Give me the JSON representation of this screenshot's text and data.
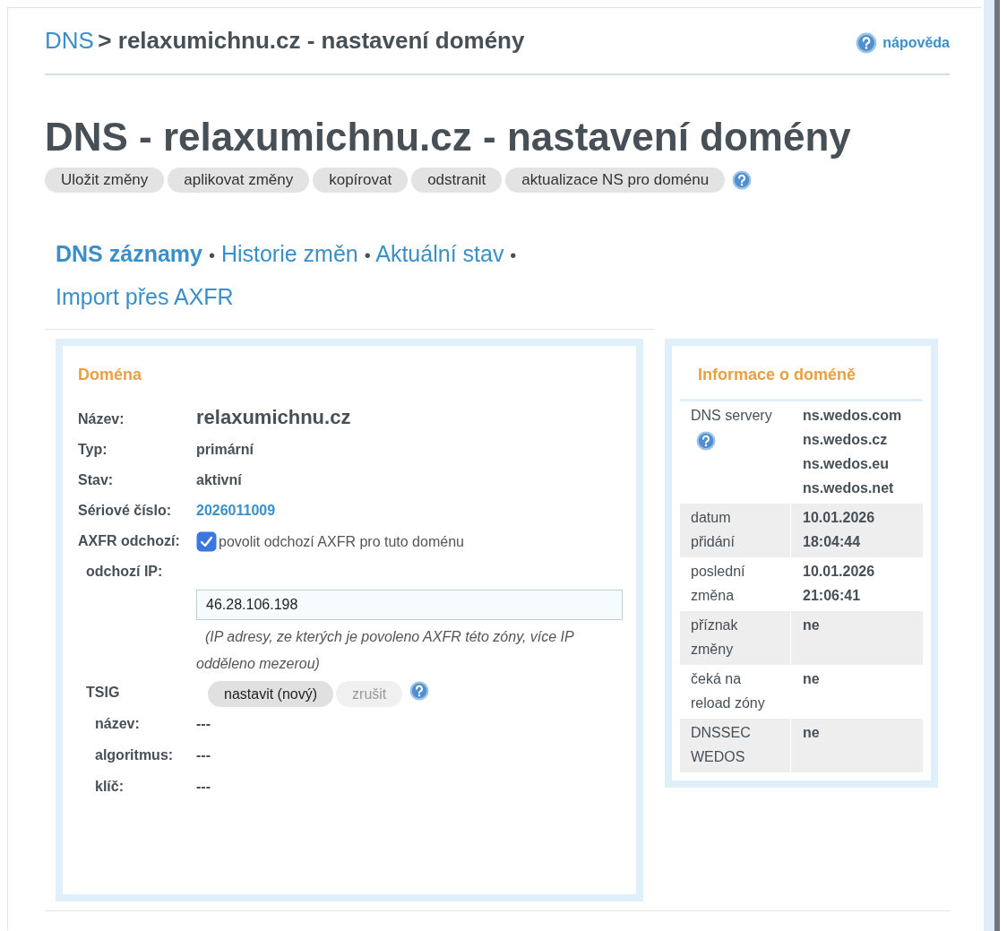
{
  "breadcrumb": [
    {
      "text": "DNS",
      "kind": "link"
    },
    {
      "text": "> relaxumichnu.cz - nastavení domény",
      "kind": "current"
    }
  ],
  "help_link": "nápověda",
  "page_title": "DNS - relaxumichnu.cz - nastavení domény",
  "toolbar": {
    "buttons": [
      "Uložit změny",
      "aplikovat změny",
      "kopírovat",
      "odstranit",
      "aktualizace NS pro doménu"
    ]
  },
  "subnav": {
    "separator": "•",
    "items": [
      {
        "label": "DNS záznamy",
        "selected": true
      },
      {
        "label": "Historie změn",
        "selected": false
      },
      {
        "label": "Aktuální stav",
        "selected": false
      },
      {
        "label": "Import přes AXFR",
        "selected": false
      }
    ]
  },
  "domain_panel": {
    "title": "Doména",
    "rows": [
      {
        "kind": "name",
        "label": "Název:",
        "value": "relaxumichnu.cz"
      },
      {
        "kind": "text",
        "label": "Typ:",
        "value": "primární"
      },
      {
        "kind": "text",
        "label": "Stav:",
        "value": "aktivní"
      },
      {
        "kind": "link",
        "label": "Sériové číslo:",
        "value": "2026011009"
      },
      {
        "kind": "checkbox",
        "label": "AXFR odchozí:",
        "checked": true,
        "text": "povolit odchozí AXFR pro tuto doménu"
      },
      {
        "kind": "input",
        "label": "odchozí IP:",
        "value": "46.28.106.198",
        "note": "(IP adresy, ze kterých je povoleno AXFR této zóny, více IP odděleno mezerou)"
      },
      {
        "kind": "buttons",
        "label": "TSIG",
        "buttons": [
          {
            "label": "nastavit (nový)",
            "disabled": false
          },
          {
            "label": "zrušit",
            "disabled": true
          }
        ]
      },
      {
        "kind": "sub",
        "label": "název:",
        "value": "---"
      },
      {
        "kind": "sub",
        "label": "algoritmus:",
        "value": "---"
      },
      {
        "kind": "sub",
        "label": "klíč:",
        "value": "---"
      }
    ]
  },
  "info_panel": {
    "title": "Informace o doméně",
    "rows": [
      {
        "label": "DNS servery",
        "help": true,
        "values": [
          "ns.wedos.com",
          "ns.wedos.cz",
          "ns.wedos.eu",
          "ns.wedos.net"
        ]
      },
      {
        "label": "datum přidání",
        "help": false,
        "values": [
          "10.01.2026 18:04:44"
        ]
      },
      {
        "label": "poslední změna",
        "help": false,
        "values": [
          "10.01.2026 21:06:41"
        ]
      },
      {
        "label": "příznak změny",
        "help": false,
        "values": [
          "ne"
        ]
      },
      {
        "label": "čeká na reload zóny",
        "help": false,
        "values": [
          "ne"
        ]
      },
      {
        "label": "DNSSEC WEDOS",
        "help": false,
        "values": [
          "ne"
        ]
      }
    ]
  }
}
